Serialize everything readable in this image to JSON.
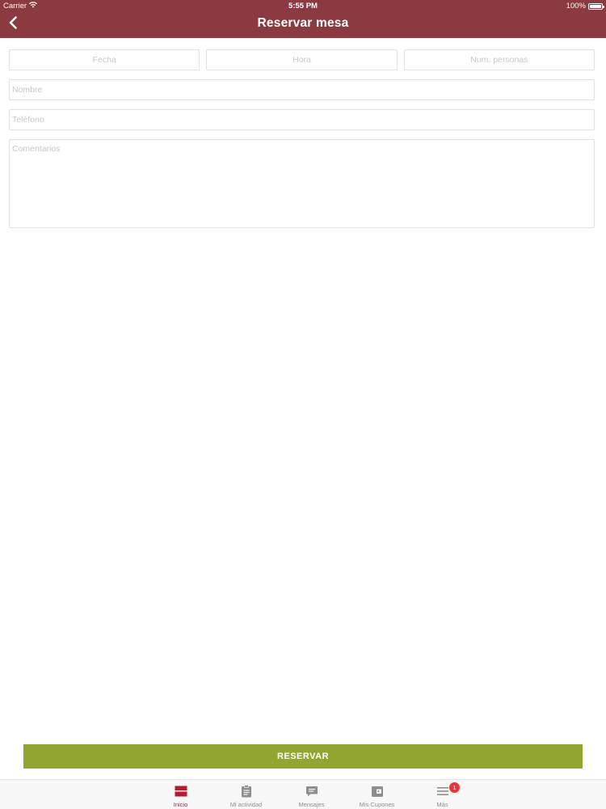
{
  "status_bar": {
    "carrier": "Carrier",
    "time": "5:55 PM",
    "battery": "100%"
  },
  "nav": {
    "title": "Reservar mesa",
    "back_icon": "chevron-left-icon"
  },
  "form": {
    "fecha_placeholder": "Fecha",
    "hora_placeholder": "Hora",
    "personas_placeholder": "Num. personas",
    "nombre_placeholder": "Nombre",
    "telefono_placeholder": "Teléfono",
    "comentarios_placeholder": "Comentarios"
  },
  "reserve_button": {
    "label": "RESERVAR",
    "color": "#93a531"
  },
  "tab_bar": {
    "tabs": [
      {
        "label": "Inicio",
        "icon": "home-icon",
        "active": true
      },
      {
        "label": "Mi actividad",
        "icon": "clipboard-icon",
        "active": false
      },
      {
        "label": "Mensajes",
        "icon": "chat-bubble-icon",
        "active": false
      },
      {
        "label": "Mis Cupones",
        "icon": "wallet-icon",
        "active": false
      },
      {
        "label": "Más",
        "icon": "menu-icon",
        "active": false,
        "badge": "1"
      }
    ]
  },
  "colors": {
    "header": "#8a3a40",
    "active_tab": "#b7192c",
    "badge": "#e8353a"
  }
}
